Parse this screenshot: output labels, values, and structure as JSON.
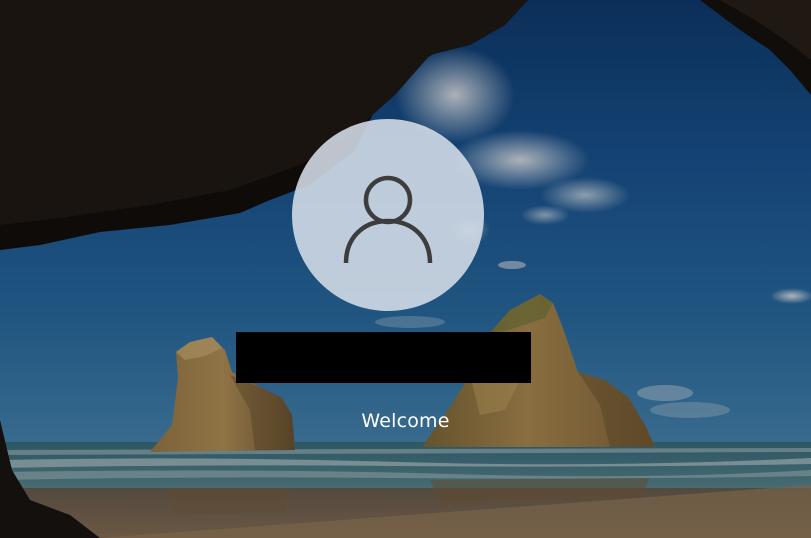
{
  "screen": {
    "type": "windows-lock-welcome"
  },
  "user": {
    "avatar_icon": "user-silhouette-icon",
    "name": ""
  },
  "status": {
    "text": "Welcome"
  },
  "colors": {
    "avatar_bg": "#d6dee8",
    "avatar_glyph": "#3d3d3d",
    "text": "#ffffff",
    "redaction": "#000000"
  }
}
